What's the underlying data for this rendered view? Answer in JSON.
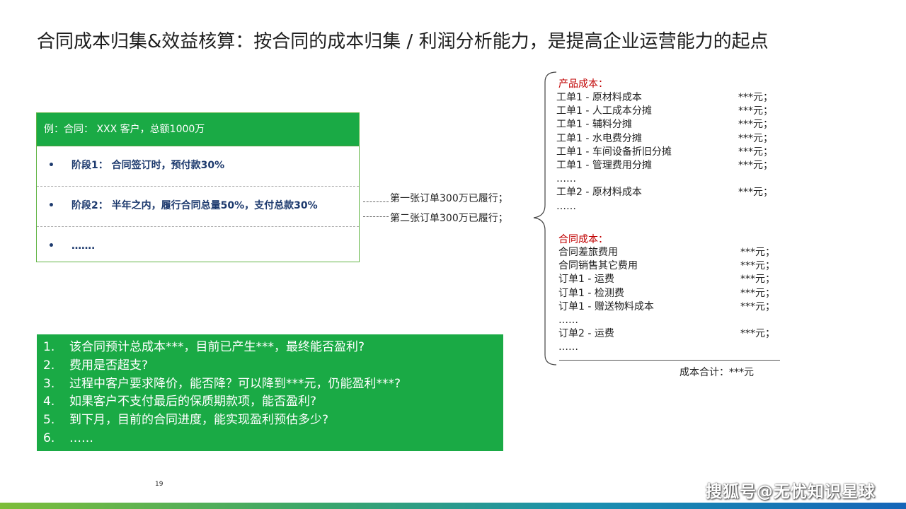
{
  "title": "合同成本归集&效益核算：按合同的成本归集 / 利润分析能力，是提高企业运营能力的起点",
  "example": {
    "header": "例：合同： XXX 客户，总额1000万",
    "stages": [
      {
        "bullet": "•",
        "text": "阶段1： 合同签订时，预付款30%"
      },
      {
        "bullet": "•",
        "text": "阶段2： 半年之内，履行合同总量50%，支付总款30%"
      },
      {
        "bullet": "•",
        "text": "……."
      }
    ]
  },
  "fulfilment": [
    "第一张订单300万已履行；",
    "第二张订单300万已履行；"
  ],
  "product_cost": {
    "title": "产品成本：",
    "rows": [
      {
        "item": "工单1 - 原材料成本",
        "amount": "***元；"
      },
      {
        "item": "工单1 - 人工成本分摊",
        "amount": "***元；"
      },
      {
        "item": "工单1 - 辅料分摊",
        "amount": "***元；"
      },
      {
        "item": "工单1 - 水电费分摊",
        "amount": "***元；"
      },
      {
        "item": "工单1 - 车间设备折旧分摊",
        "amount": "***元；"
      },
      {
        "item": "工单1 - 管理费用分摊",
        "amount": "***元；"
      },
      {
        "item": "……",
        "amount": ""
      },
      {
        "item": "工单2 - 原材料成本",
        "amount": "***元；"
      },
      {
        "item": "……",
        "amount": ""
      }
    ]
  },
  "contract_cost": {
    "title": "合同成本：",
    "rows": [
      {
        "item": "合同差旅费用",
        "amount": "***元；"
      },
      {
        "item": "合同销售其它费用",
        "amount": "***元；"
      },
      {
        "item": "订单1 - 运费",
        "amount": "***元；"
      },
      {
        "item": "订单1 - 检测费",
        "amount": "***元；"
      },
      {
        "item": "订单1 - 赠送物料成本",
        "amount": "***元；"
      },
      {
        "item": "……",
        "amount": ""
      },
      {
        "item": "订单2 - 运费",
        "amount": "***元；"
      },
      {
        "item": "……",
        "amount": ""
      }
    ]
  },
  "total": "成本合计：***元",
  "questions": [
    {
      "num": "1.",
      "text": "该合同预计总成本***，目前已产生***，最终能否盈利?"
    },
    {
      "num": "2.",
      "text": "费用是否超支?"
    },
    {
      "num": "3.",
      "text": "过程中客户要求降价，能否降？可以降到***元，仍能盈利***?"
    },
    {
      "num": "4.",
      "text": "如果客户不支付最后的保质期款项，能否盈利?"
    },
    {
      "num": "5.",
      "text": "到下月，目前的合同进度，能实现盈利预估多少?"
    },
    {
      "num": "6.",
      "text": "……"
    }
  ],
  "page_number": "19",
  "watermark": "搜狐号@无忧知识星球",
  "colors": {
    "accent_green": "#1aaa45",
    "section_red": "#c00000",
    "stage_blue": "#1d3a6e"
  }
}
